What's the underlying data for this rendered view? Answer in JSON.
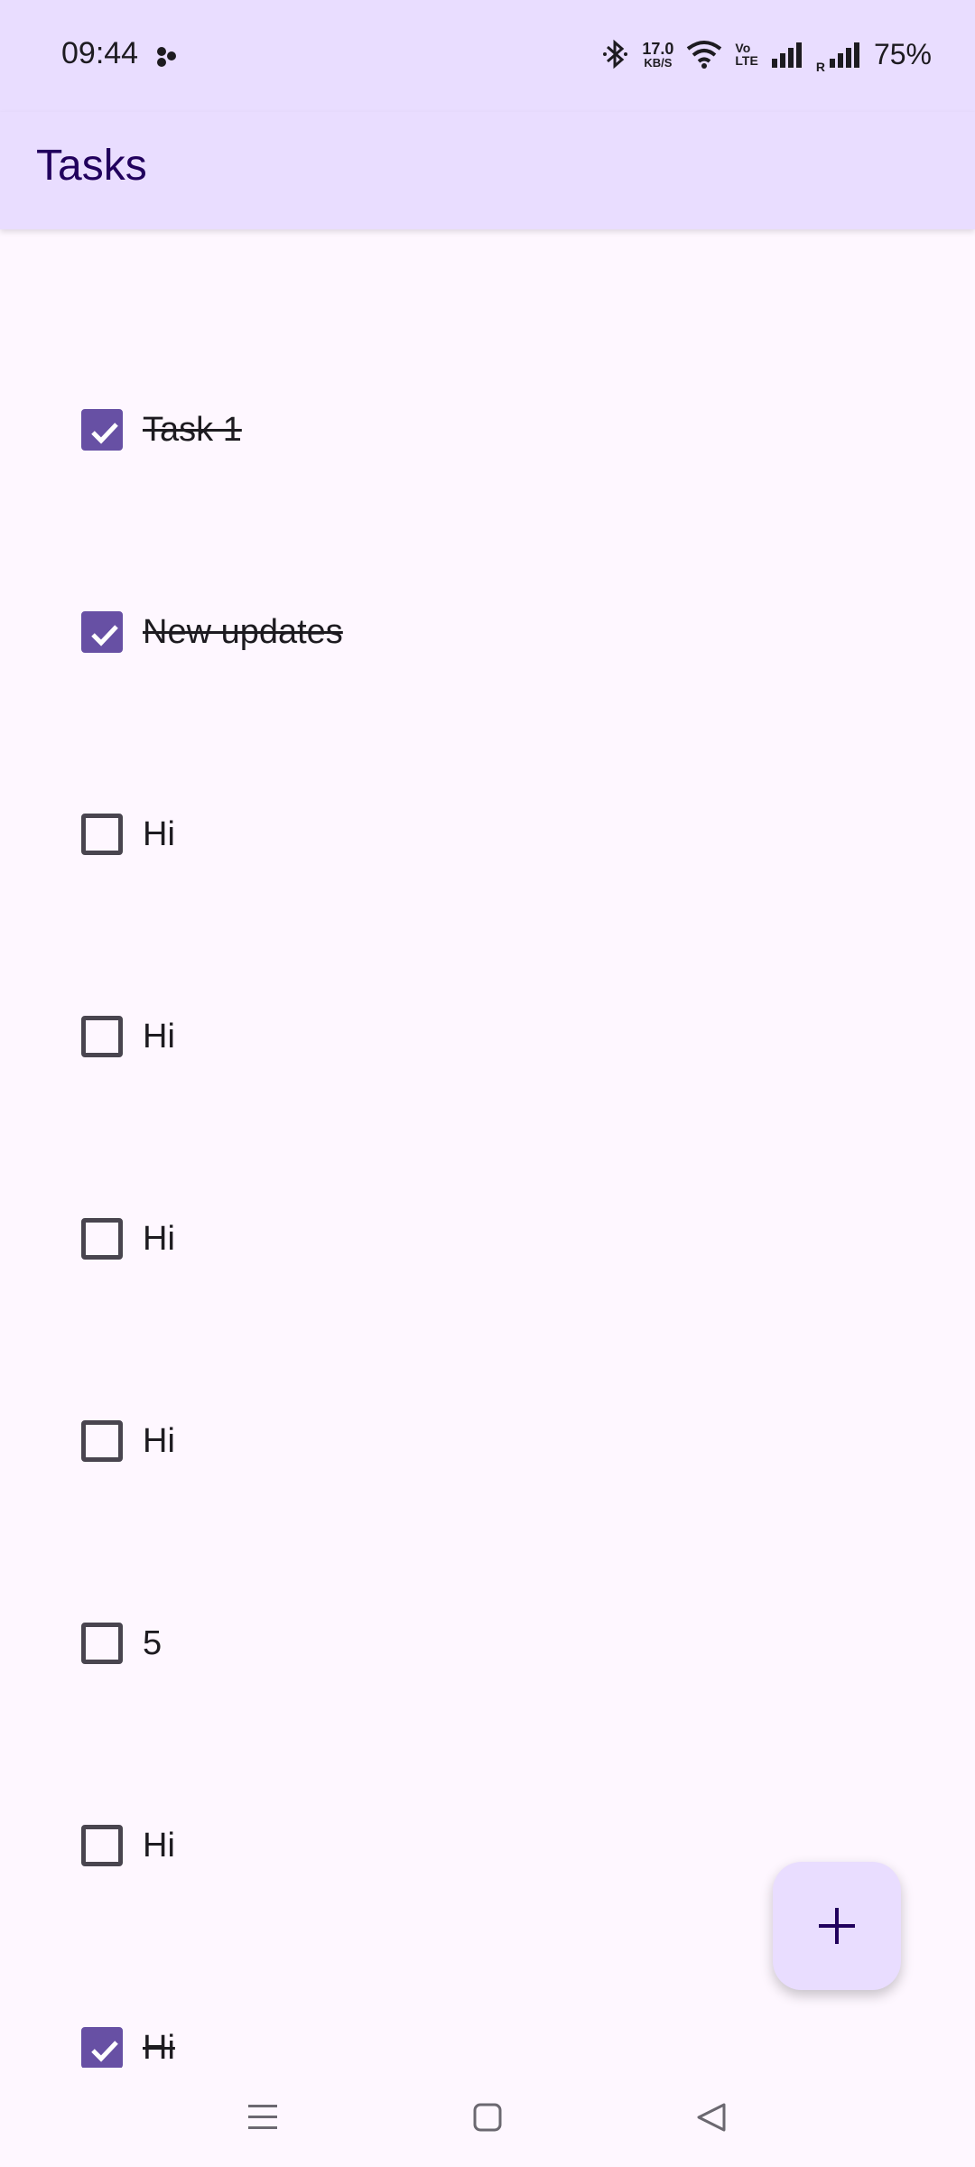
{
  "status_bar": {
    "time": "09:44",
    "net_speed_value": "17.0",
    "net_speed_unit": "KB/S",
    "volte_top": "Vo",
    "volte_bottom": "LTE",
    "roaming": "R",
    "battery": "75%"
  },
  "app_bar": {
    "title": "Tasks"
  },
  "tasks": [
    {
      "label": "Task 1",
      "checked": true
    },
    {
      "label": "New updates",
      "checked": true
    },
    {
      "label": "Hi",
      "checked": false
    },
    {
      "label": "Hi",
      "checked": false
    },
    {
      "label": "Hi",
      "checked": false
    },
    {
      "label": "Hi",
      "checked": false
    },
    {
      "label": "5",
      "checked": false
    },
    {
      "label": "Hi",
      "checked": false
    },
    {
      "label": "Hi",
      "checked": true
    }
  ],
  "fab": {
    "icon": "plus-icon"
  },
  "navigation": {
    "recents_icon": "menu-icon",
    "home_icon": "home-square-icon",
    "back_icon": "back-triangle-icon"
  },
  "colors": {
    "app_bar_bg": "#e9ddff",
    "background": "#fef7ff",
    "accent": "#6750a4",
    "title": "#21005d"
  }
}
